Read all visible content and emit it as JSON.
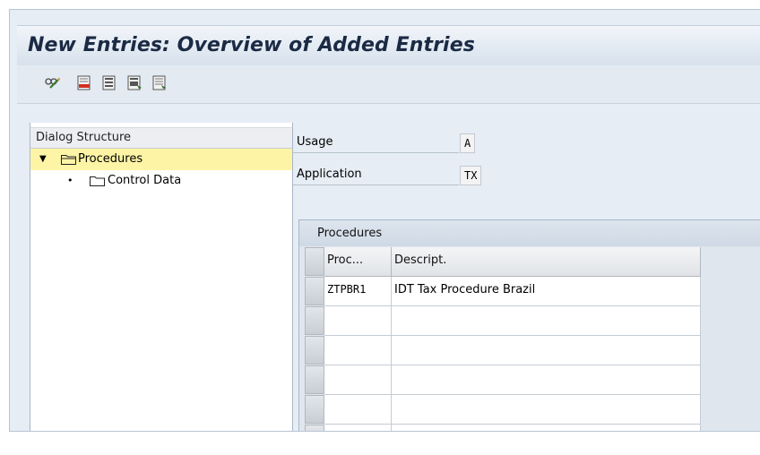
{
  "header": {
    "title": "New Entries: Overview of Added Entries"
  },
  "toolbar": {
    "buttons": [
      {
        "icon": "glasses-display-change-icon"
      },
      {
        "icon": "delete-entry-icon"
      },
      {
        "icon": "select-all-icon"
      },
      {
        "icon": "select-block-icon"
      },
      {
        "icon": "deselect-all-icon"
      }
    ]
  },
  "dialog_structure": {
    "header": "Dialog Structure",
    "items": [
      {
        "label": "Procedures",
        "selected": true
      },
      {
        "label": "Control Data",
        "selected": false
      }
    ]
  },
  "fields": {
    "usage": {
      "label": "Usage",
      "value": "A"
    },
    "application": {
      "label": "Application",
      "value": "TX"
    }
  },
  "table": {
    "title": "Procedures",
    "columns": [
      "Proc...",
      "Descript."
    ],
    "rows": [
      {
        "proc": "ZTPBR1",
        "descript": "IDT Tax Procedure Brazil"
      },
      {
        "proc": "",
        "descript": ""
      },
      {
        "proc": "",
        "descript": ""
      },
      {
        "proc": "",
        "descript": ""
      },
      {
        "proc": "",
        "descript": ""
      },
      {
        "proc": "",
        "descript": ""
      }
    ]
  },
  "colors": {
    "title_text": "#1b2a44",
    "selected_row": "#fdf4a6",
    "panel_bg": "#e6edf5"
  }
}
